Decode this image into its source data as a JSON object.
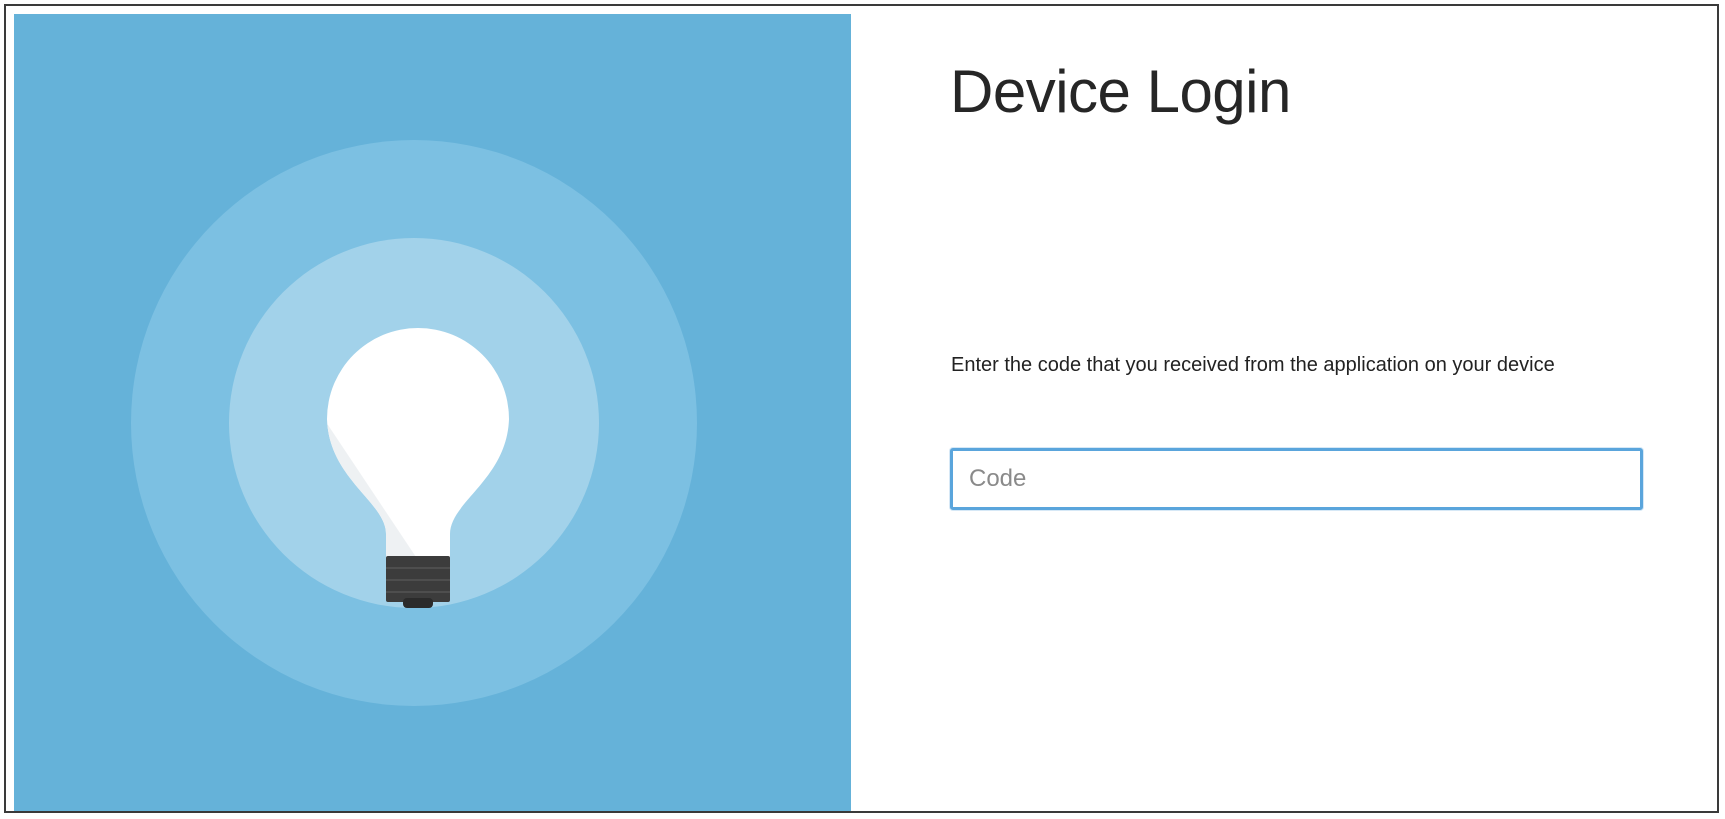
{
  "page": {
    "title": "Device Login",
    "instruction": "Enter the code that you received from the application on your device"
  },
  "form": {
    "code_placeholder": "Code",
    "code_value": ""
  },
  "illustration": {
    "icon": "lightbulb-icon",
    "colors": {
      "background": "#65b2d9",
      "outer_ring": "#7cc0e2",
      "inner_ring": "#a2d2ea",
      "bulb": "#ffffff",
      "bulb_shade": "#eef1f3",
      "base": "#3c3c3c"
    }
  },
  "colors": {
    "input_border": "#5aa5dc",
    "title_text": "#262626"
  }
}
